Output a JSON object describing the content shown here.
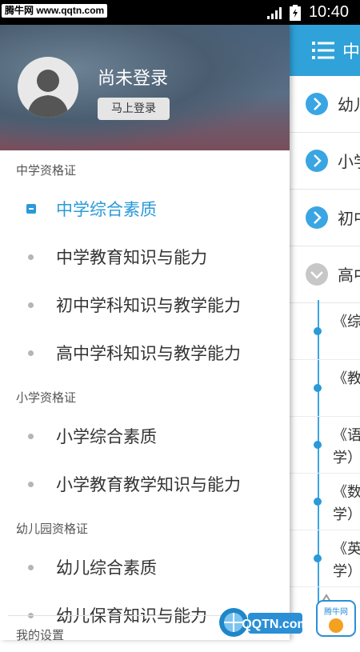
{
  "status_bar": {
    "watermark": "腾牛网 www.qqtn.com",
    "time": "10:40"
  },
  "drawer": {
    "profile": {
      "username": "尚未登录",
      "login_button": "马上登录"
    },
    "sections": [
      {
        "title": "中学资格证",
        "items": [
          "中学综合素质",
          "中学教育知识与能力",
          "初中学科知识与教学能力",
          "高中学科知识与教学能力"
        ]
      },
      {
        "title": "小学资格证",
        "items": [
          "小学综合素质",
          "小学教育教学知识与能力"
        ]
      },
      {
        "title": "幼儿园资格证",
        "items": [
          "幼儿综合素质",
          "幼儿保育知识与能力"
        ]
      },
      {
        "title": "我的设置"
      }
    ],
    "active_item": "中学综合素质"
  },
  "content": {
    "header_title": "中学",
    "categories": [
      {
        "label": "幼儿",
        "expanded": false
      },
      {
        "label": "小学",
        "expanded": false
      },
      {
        "label": "初中",
        "expanded": false
      },
      {
        "label": "高中",
        "expanded": true
      }
    ],
    "books": [
      {
        "line1": "《综"
      },
      {
        "line1": "《教"
      },
      {
        "line1": "《语",
        "line2": "学）"
      },
      {
        "line1": "《数",
        "line2": "学）"
      },
      {
        "line1": "《英",
        "line2": "学）"
      }
    ]
  },
  "bottom_logo": {
    "text": "QQTN.com",
    "badge": "腾牛网"
  },
  "colors": {
    "accent": "#2fa2d9",
    "active_text": "#2a9ad8",
    "bullet": "#b5b5b5"
  }
}
